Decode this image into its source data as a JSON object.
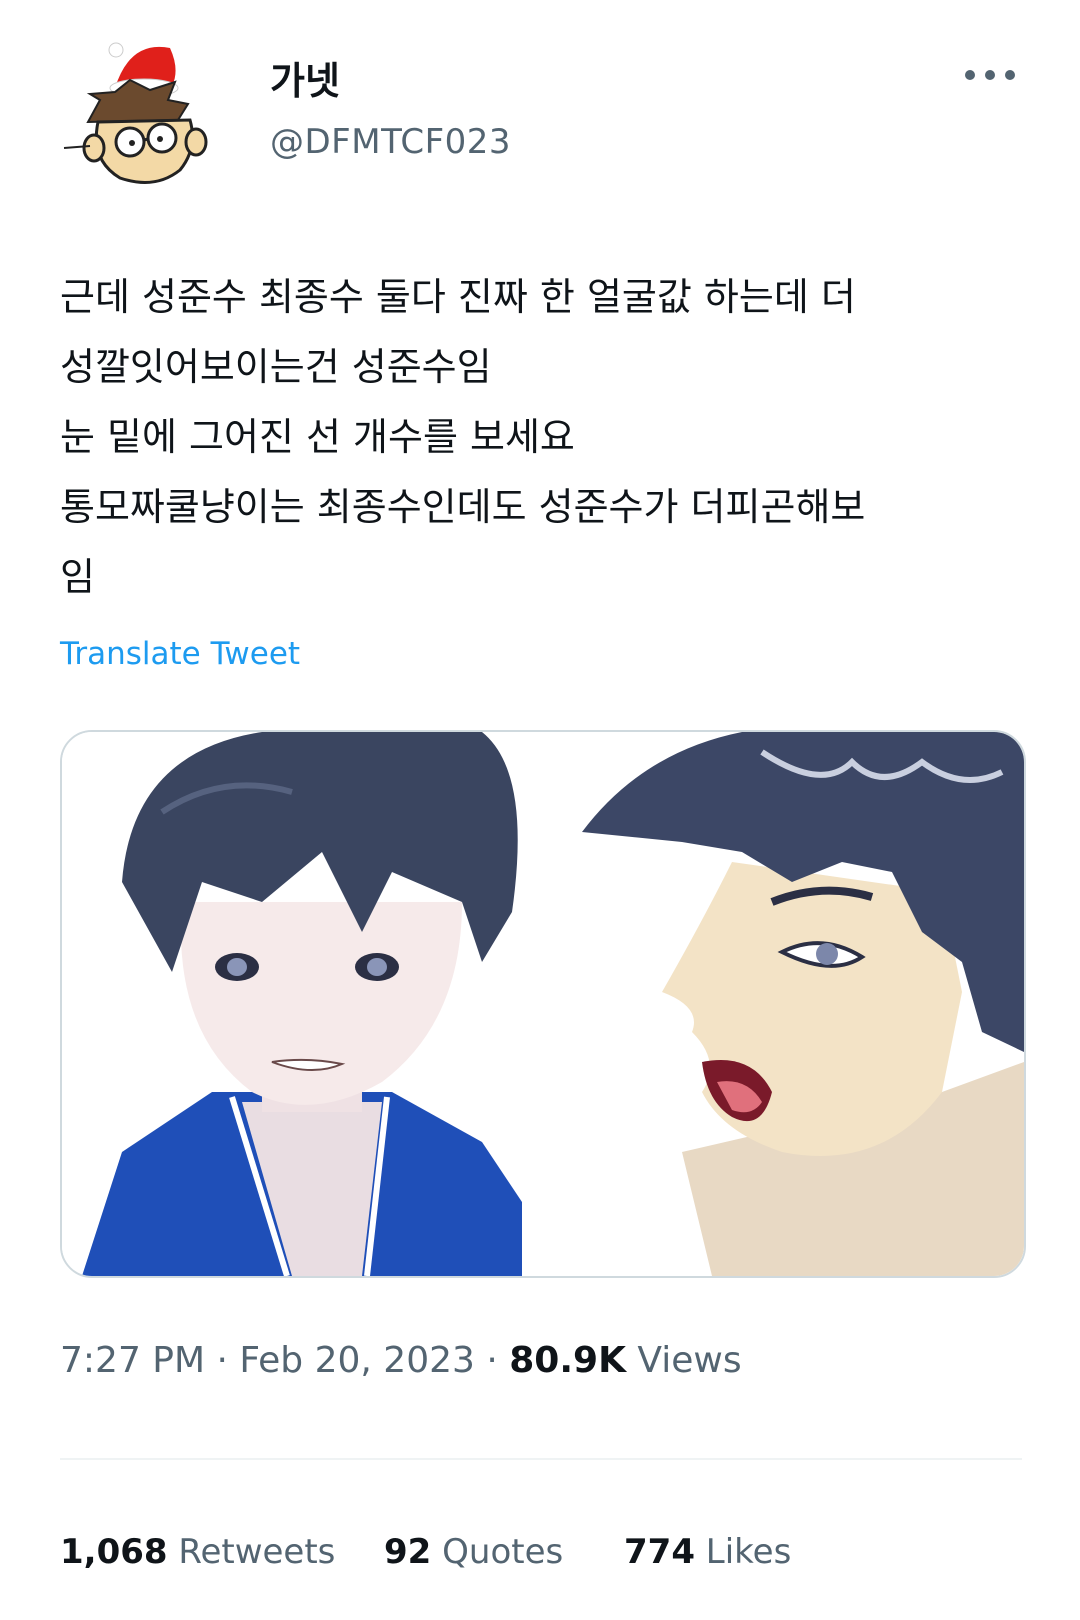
{
  "user": {
    "display_name": "가넷",
    "handle": "@DFMTCF023"
  },
  "icons": {
    "more": "more-horizontal-icon"
  },
  "tweet": {
    "lines": [
      "근데 성준수 최종수 둘다 진짜 한 얼굴값 하는데 더",
      "성깔잇어보이는건 성준수임",
      "눈 밑에 그어진 선 개수를 보세요",
      "통모짜쿨냥이는 최종수인데도 성준수가 더피곤해보",
      "임"
    ],
    "translate_label": "Translate Tweet"
  },
  "meta": {
    "time": "7:27 PM",
    "date": "Feb 20, 2023",
    "views_count": "80.9K",
    "views_label": "Views"
  },
  "stats": {
    "retweets_count": "1,068",
    "retweets_label": "Retweets",
    "quotes_count": "92",
    "quotes_label": "Quotes",
    "likes_count": "774",
    "likes_label": "Likes"
  },
  "colors": {
    "text": "#0f1419",
    "secondary": "#536471",
    "link": "#1d9bf0",
    "border": "#cfd9de"
  }
}
